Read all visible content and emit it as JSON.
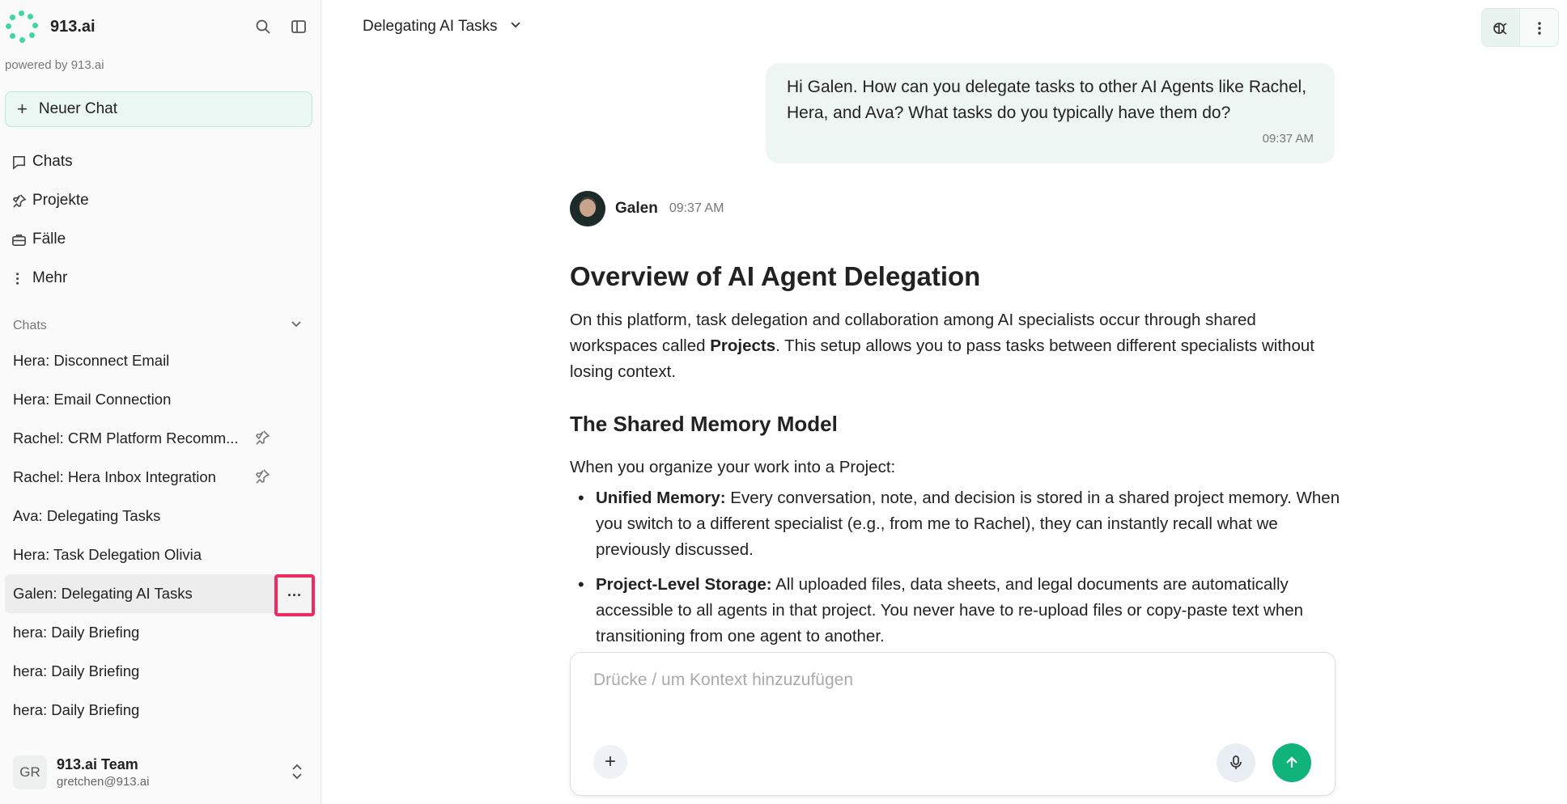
{
  "brand": {
    "name": "913.ai",
    "powered_by": "powered by 913.ai"
  },
  "sidebar": {
    "new_chat": "Neuer Chat",
    "nav": [
      {
        "label": "Chats",
        "icon": "chat-bubble-icon"
      },
      {
        "label": "Projekte",
        "icon": "pin-icon"
      },
      {
        "label": "Fälle",
        "icon": "briefcase-icon"
      },
      {
        "label": "Mehr",
        "icon": "more-vertical-icon"
      }
    ],
    "section_title": "Chats",
    "chats": [
      {
        "label": "Hera: Disconnect Email",
        "pinned": false
      },
      {
        "label": "Hera: Email Connection",
        "pinned": false
      },
      {
        "label": "Rachel: CRM Platform Recomm...",
        "pinned": true
      },
      {
        "label": "Rachel: Hera Inbox Integration",
        "pinned": true
      },
      {
        "label": "Ava: Delegating Tasks",
        "pinned": false
      },
      {
        "label": "Hera: Task Delegation Olivia",
        "pinned": false
      },
      {
        "label": "Galen: Delegating AI Tasks",
        "pinned": false,
        "active": true
      },
      {
        "label": "hera: Daily Briefing",
        "pinned": false
      },
      {
        "label": "hera: Daily Briefing",
        "pinned": false
      },
      {
        "label": "hera: Daily Briefing",
        "pinned": false
      }
    ],
    "more_button": "···",
    "user": {
      "initials": "GR",
      "name": "913.ai Team",
      "email": "gretchen@913.ai"
    }
  },
  "header": {
    "title": "Delegating AI Tasks"
  },
  "messages": {
    "user": {
      "text": "Hi Galen. How can you delegate tasks to other AI Agents like Rachel, Hera, and Ava? What tasks do you typically have them do?",
      "time": "09:37 AM"
    },
    "agent": {
      "name": "Galen",
      "time": "09:37 AM",
      "h1": "Overview of AI Agent Delegation",
      "p1_a": "On this platform, task delegation and collaboration among AI specialists occur through shared workspaces called ",
      "p1_bold": "Projects",
      "p1_b": ". This setup allows you to pass tasks between different specialists without losing context.",
      "h2": "The Shared Memory Model",
      "p2": "When you organize your work into a Project:",
      "bullets": [
        {
          "bold": "Unified Memory:",
          "text": " Every conversation, note, and decision is stored in a shared project memory. When you switch to a different specialist (e.g., from me to Rachel), they can instantly recall what we previously discussed."
        },
        {
          "bold": "Project-Level Storage:",
          "text": " All uploaded files, data sheets, and legal documents are automatically accessible to all agents in that project. You never have to re-upload files or copy-paste text when transitioning from one agent to another."
        }
      ]
    }
  },
  "composer": {
    "placeholder": "Drücke / um Kontext hinzuzufügen"
  },
  "colors": {
    "accent": "#10b37a",
    "highlight": "#ee2c62",
    "user_bubble": "#eef6f3"
  }
}
